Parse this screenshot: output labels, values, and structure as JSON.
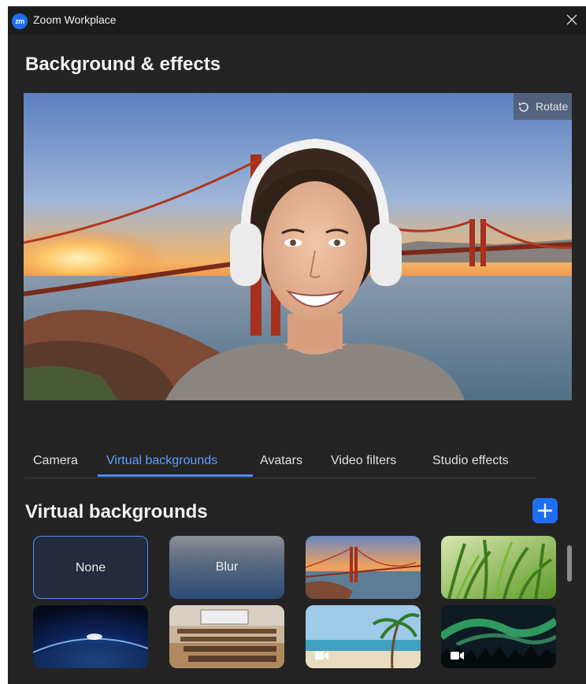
{
  "window": {
    "app_logo": "zm",
    "app_title": "Zoom Workplace",
    "close_icon": "close-icon"
  },
  "page_title": "Background & effects",
  "preview": {
    "rotate_label": "Rotate",
    "rotate_icon": "rotate-icon"
  },
  "tabs": [
    {
      "label": "Camera",
      "active": false
    },
    {
      "label": "Virtual backgrounds",
      "active": true
    },
    {
      "label": "Avatars",
      "active": false
    },
    {
      "label": "Video filters",
      "active": false
    },
    {
      "label": "Studio effects",
      "active": false
    }
  ],
  "section": {
    "title": "Virtual backgrounds",
    "add_icon": "plus-icon"
  },
  "backgrounds": [
    {
      "label": "None",
      "selected": true
    },
    {
      "label": "Blur",
      "selected": false
    },
    {
      "label": "",
      "image": "golden-gate-bridge"
    },
    {
      "label": "",
      "image": "grass"
    },
    {
      "label": "",
      "image": "earth-from-space"
    },
    {
      "label": "",
      "image": "classroom"
    },
    {
      "label": "",
      "image": "beach-palm",
      "video": true
    },
    {
      "label": "",
      "image": "aurora",
      "video": true
    }
  ],
  "colors": {
    "accent": "#4a8cff",
    "window_bg": "#232323",
    "titlebar_bg": "#1c1c1c"
  }
}
